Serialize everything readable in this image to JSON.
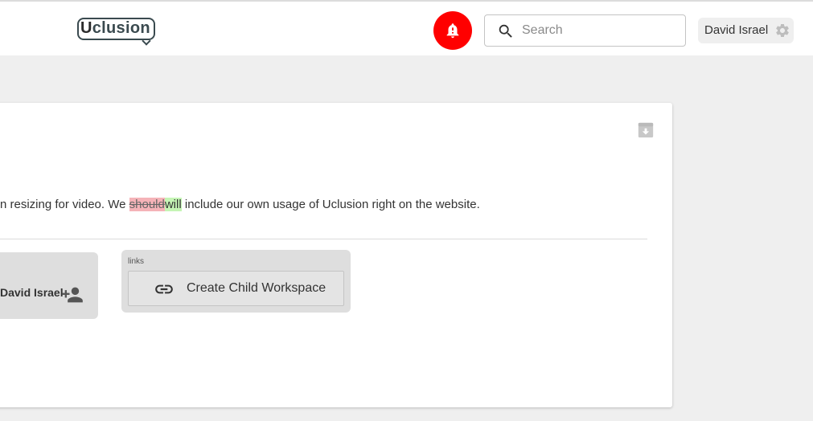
{
  "header": {
    "logo": {
      "first_letter": "U",
      "rest": "clusion"
    },
    "search": {
      "placeholder": "Search",
      "value": ""
    },
    "user": {
      "name": "David Israel"
    },
    "icons": {
      "notification": "bell-alert-icon",
      "search": "search-icon",
      "settings": "gear-icon"
    },
    "colors": {
      "notification_bg": "#ff0000"
    }
  },
  "card": {
    "description": {
      "before": "n resizing for video. We ",
      "deleted": "should",
      "inserted": "will",
      "after": " include our own usage of Uclusion right on the website."
    },
    "assigned": {
      "name": "David Israel",
      "icon": "person-add-icon"
    },
    "links": {
      "label": "links",
      "create_child_label": "Create Child Workspace",
      "icon": "link-icon"
    },
    "archive_icon": "archive-icon",
    "colors": {
      "deleted_bg": "#f5b3b8",
      "inserted_bg": "#c5f5b5"
    }
  }
}
